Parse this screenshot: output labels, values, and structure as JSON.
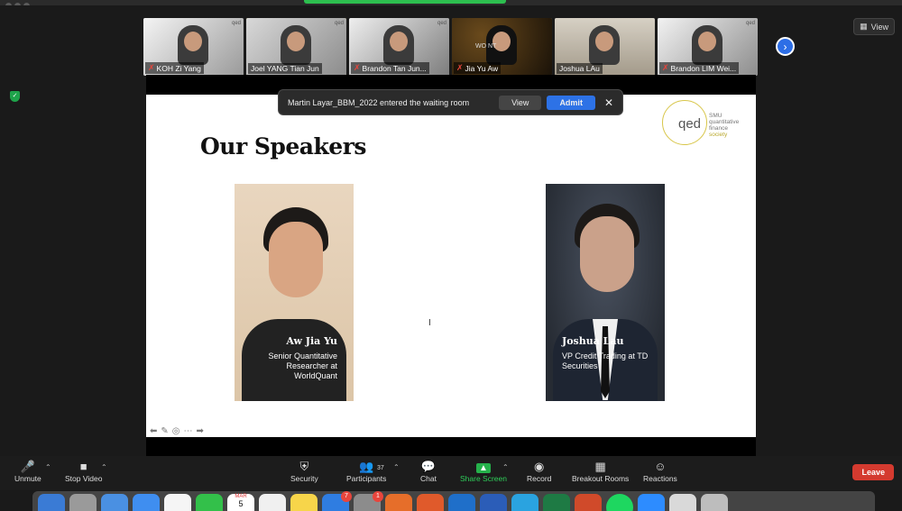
{
  "meeting": {
    "view_label": "View",
    "participants_strip": [
      {
        "name": "KOH Zi Yang",
        "muted": true,
        "logo": "qed"
      },
      {
        "name": "Joel YANG Tian Jun",
        "muted": false,
        "logo": "qed"
      },
      {
        "name": "Brandon Tan Jun...",
        "muted": true,
        "logo": "qed"
      },
      {
        "name": "Jia Yu Aw",
        "muted": true,
        "logo": "WO  NT"
      },
      {
        "name": "Joshua LAu",
        "muted": false,
        "logo": ""
      },
      {
        "name": "Brandon LIM Wei...",
        "muted": true,
        "logo": "qed"
      }
    ],
    "next_icon": "chevron-right-icon",
    "security_icon": "shield-check-icon"
  },
  "waiting_room": {
    "message": "Martin Layar_BBM_2022 entered the waiting room",
    "view_label": "View",
    "admit_label": "Admit",
    "close_glyph": "✕"
  },
  "slide": {
    "title": "Our Speakers",
    "logo": {
      "mark": "qed",
      "line1": "SMU",
      "line2": "quantitative",
      "line3": "finance",
      "line4": "society"
    },
    "speakers": [
      {
        "name": "Aw Jia Yu",
        "role_lines": [
          "Senior Quantitative",
          "Researcher at",
          "WorldQuant"
        ]
      },
      {
        "name": "Joshua Lau",
        "role_lines": [
          "VP Credit Trading at TD",
          "Securities"
        ]
      }
    ],
    "cursor_glyph": "I"
  },
  "toolbar": {
    "unmute": "Unmute",
    "stop_video": "Stop Video",
    "security": "Security",
    "participants": "Participants",
    "participants_count": "37",
    "chat": "Chat",
    "share_screen": "Share Screen",
    "record": "Record",
    "breakout_rooms": "Breakout Rooms",
    "reactions": "Reactions",
    "leave": "Leave"
  },
  "dock": {
    "calendar_month": "MAR",
    "calendar_day": "5",
    "badges": [
      "7",
      "1"
    ]
  },
  "colors": {
    "accent_blue": "#2d72e6",
    "share_green": "#25b24b",
    "leave_red": "#d43a2f",
    "speaking_outline": "#e6d24a"
  }
}
